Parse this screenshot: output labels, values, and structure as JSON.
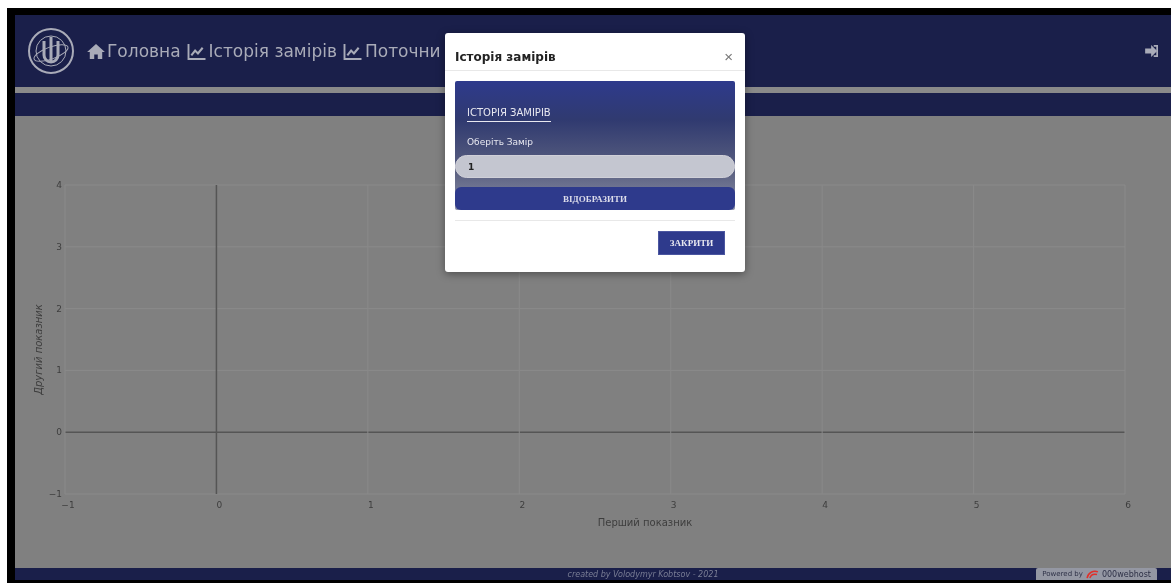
{
  "navbar": {
    "items": [
      {
        "label": "Головна",
        "kind": "home"
      },
      {
        "label": "Історія замірів",
        "kind": "chart"
      },
      {
        "label": "Поточни",
        "kind": "chart"
      }
    ]
  },
  "chart_data": {
    "type": "scatter",
    "xlabel": "Перший показник",
    "ylabel": "Другий показник",
    "xlim": [
      -1,
      6
    ],
    "ylim": [
      -1,
      4
    ],
    "xticks": [
      {
        "value": -1,
        "label": "−1"
      },
      0,
      1,
      2,
      3,
      4,
      5,
      6
    ],
    "yticks": [
      {
        "value": -1,
        "label": "−1"
      },
      0,
      1,
      2,
      3,
      4
    ],
    "grid": true
  },
  "footer": {
    "credit": "created by Volodymyr Kobtsov - 2021",
    "badge": "Powered by",
    "badge_brand": "000webhost"
  },
  "modal": {
    "title": "Історія замірів",
    "close": "×",
    "heading": "ІСТОРІЯ ЗАМІРІВ",
    "label": "Оберіть Замір",
    "value": "1",
    "submit": "ВІДОБРАЗИТИ",
    "dismiss": "ЗАКРИТИ"
  }
}
